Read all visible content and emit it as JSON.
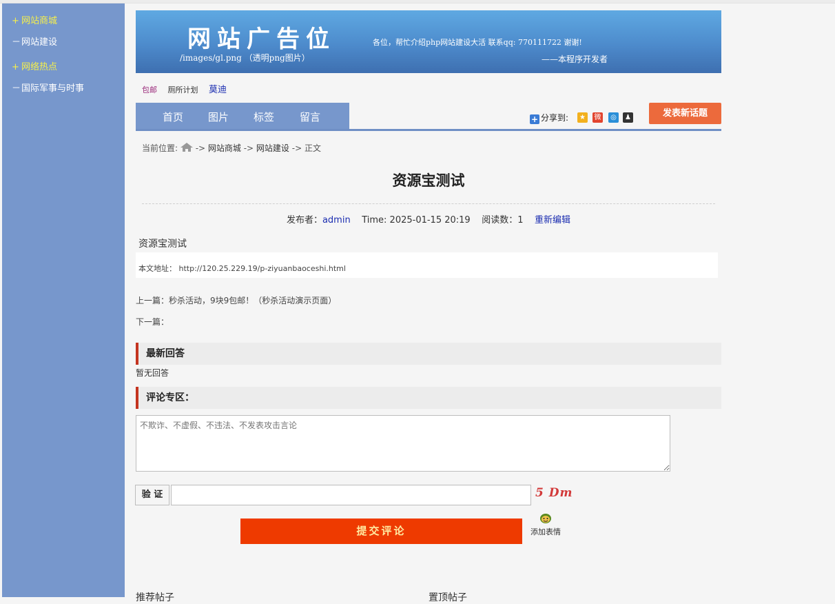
{
  "sidebar": {
    "items": [
      {
        "sign": "+",
        "label": "网站商城"
      },
      {
        "sign": "－",
        "label": "网站建设"
      },
      {
        "sign": "+",
        "label": "网络热点"
      },
      {
        "sign": "－",
        "label": "国际军事与时事"
      }
    ]
  },
  "banner": {
    "title": "网站广告位",
    "path": "/images/gl.png （透明png图片）",
    "message": "各位，帮忙介绍php网站建设大活  联系qq: 770111722 谢谢!",
    "signature": "——本程序开发者"
  },
  "tags": [
    "包邮",
    "厕所计划",
    "莫迪"
  ],
  "nav": {
    "tabs": [
      "首页",
      "图片",
      "标签",
      "留言"
    ],
    "share_label": "分享到:",
    "share_icons": [
      "qzone-icon",
      "weibo-icon",
      "tencent-weibo-icon",
      "qq-icon"
    ],
    "post_button": "发表新话题"
  },
  "breadcrumb": {
    "prefix": "当前位置:",
    "sep": " -> ",
    "items": [
      "网站商城",
      "网站建设"
    ],
    "current": "正文"
  },
  "article": {
    "title": "资源宝测试",
    "author_label": "发布者：",
    "author": "admin",
    "time": "Time: 2025-01-15 20:19",
    "views": "阅读数：1",
    "edit": "重新编辑",
    "body": "资源宝测试",
    "url_line": "本文地址：  http://120.25.229.19/p-ziyuanbaoceshi.html",
    "prev": "上一篇：秒杀活动，9块9包邮！（秒杀活动演示页面）",
    "next": "下一篇："
  },
  "replies": {
    "heading": "最新回答",
    "empty": "暂无回答"
  },
  "comment": {
    "heading": "评论专区：",
    "placeholder": "不欺诈、不虚假、不违法、不发表攻击言论",
    "verify_label": "验 证",
    "captcha": "5 Dm",
    "submit": "提交评论",
    "emoji": "添加表情"
  },
  "bottom": {
    "left": "推荐帖子",
    "right": "置顶帖子"
  },
  "colors": {
    "sidebar": "#7797cc",
    "highlight": "#f6ef4b",
    "submit": "#ee3a00",
    "post_button": "#ec6a3c",
    "section_accent": "#c43420"
  }
}
